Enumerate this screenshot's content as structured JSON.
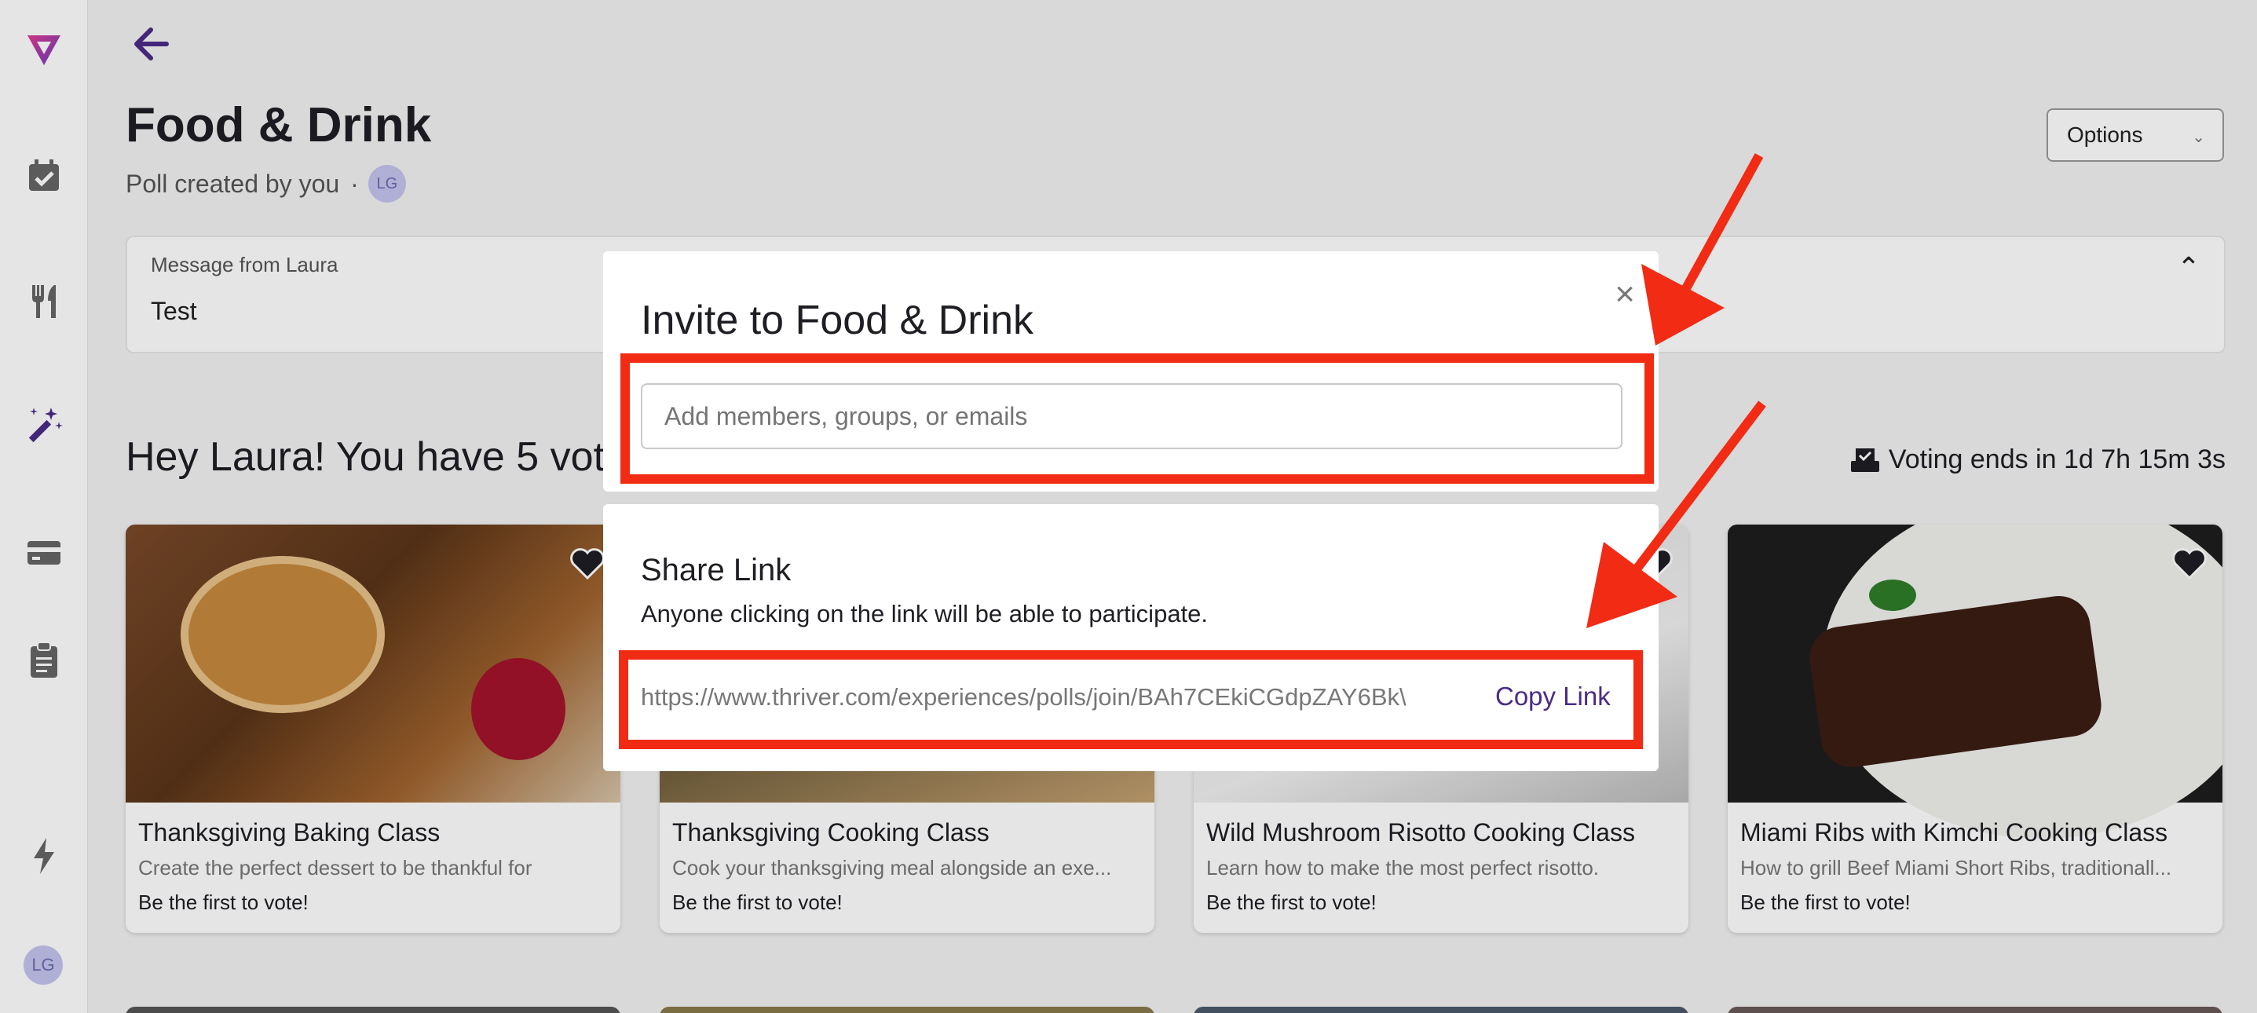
{
  "sidebar": {
    "icons": [
      "thriver-logo-icon",
      "calendar-check-icon",
      "utensils-icon",
      "magic-wand-icon",
      "credit-card-icon",
      "clipboard-icon",
      "lightning-icon"
    ],
    "user_initials": "LG"
  },
  "header": {
    "title": "Food & Drink",
    "subtitle": "Poll created by you",
    "separator": "·",
    "creator_initials": "LG",
    "options_label": "Options"
  },
  "message": {
    "label": "Message from Laura",
    "text": "Test"
  },
  "votes": {
    "greeting": "Hey Laura! You have 5 vot",
    "voting_ends": "Voting ends in 1d 7h 15m 3s"
  },
  "cards": [
    {
      "title": "Thanksgiving Baking Class",
      "desc": "Create the perfect dessert to be thankful for",
      "vote": "Be the first to vote!"
    },
    {
      "title": "Thanksgiving Cooking Class",
      "desc": "Cook your thanksgiving meal alongside an exe...",
      "vote": "Be the first to vote!"
    },
    {
      "title": "Wild Mushroom Risotto Cooking Class",
      "desc": "Learn how to make the most perfect risotto.",
      "vote": "Be the first to vote!"
    },
    {
      "title": "Miami Ribs with Kimchi Cooking Class",
      "desc": "How to grill Beef Miami Short Ribs, traditionall...",
      "vote": "Be the first to vote!"
    }
  ],
  "invite_modal": {
    "title": "Invite to Food & Drink",
    "close": "×",
    "input_placeholder": "Add members, groups, or emails"
  },
  "share": {
    "title": "Share Link",
    "description": "Anyone clicking on the link will be able to participate.",
    "url": "https://www.thriver.com/experiences/polls/join/BAh7CEkiCGdpZAY6Bk\\",
    "copy_label": "Copy Link"
  },
  "colors": {
    "brand_purple": "#4a2b87",
    "annotation_red": "#f12b14"
  }
}
